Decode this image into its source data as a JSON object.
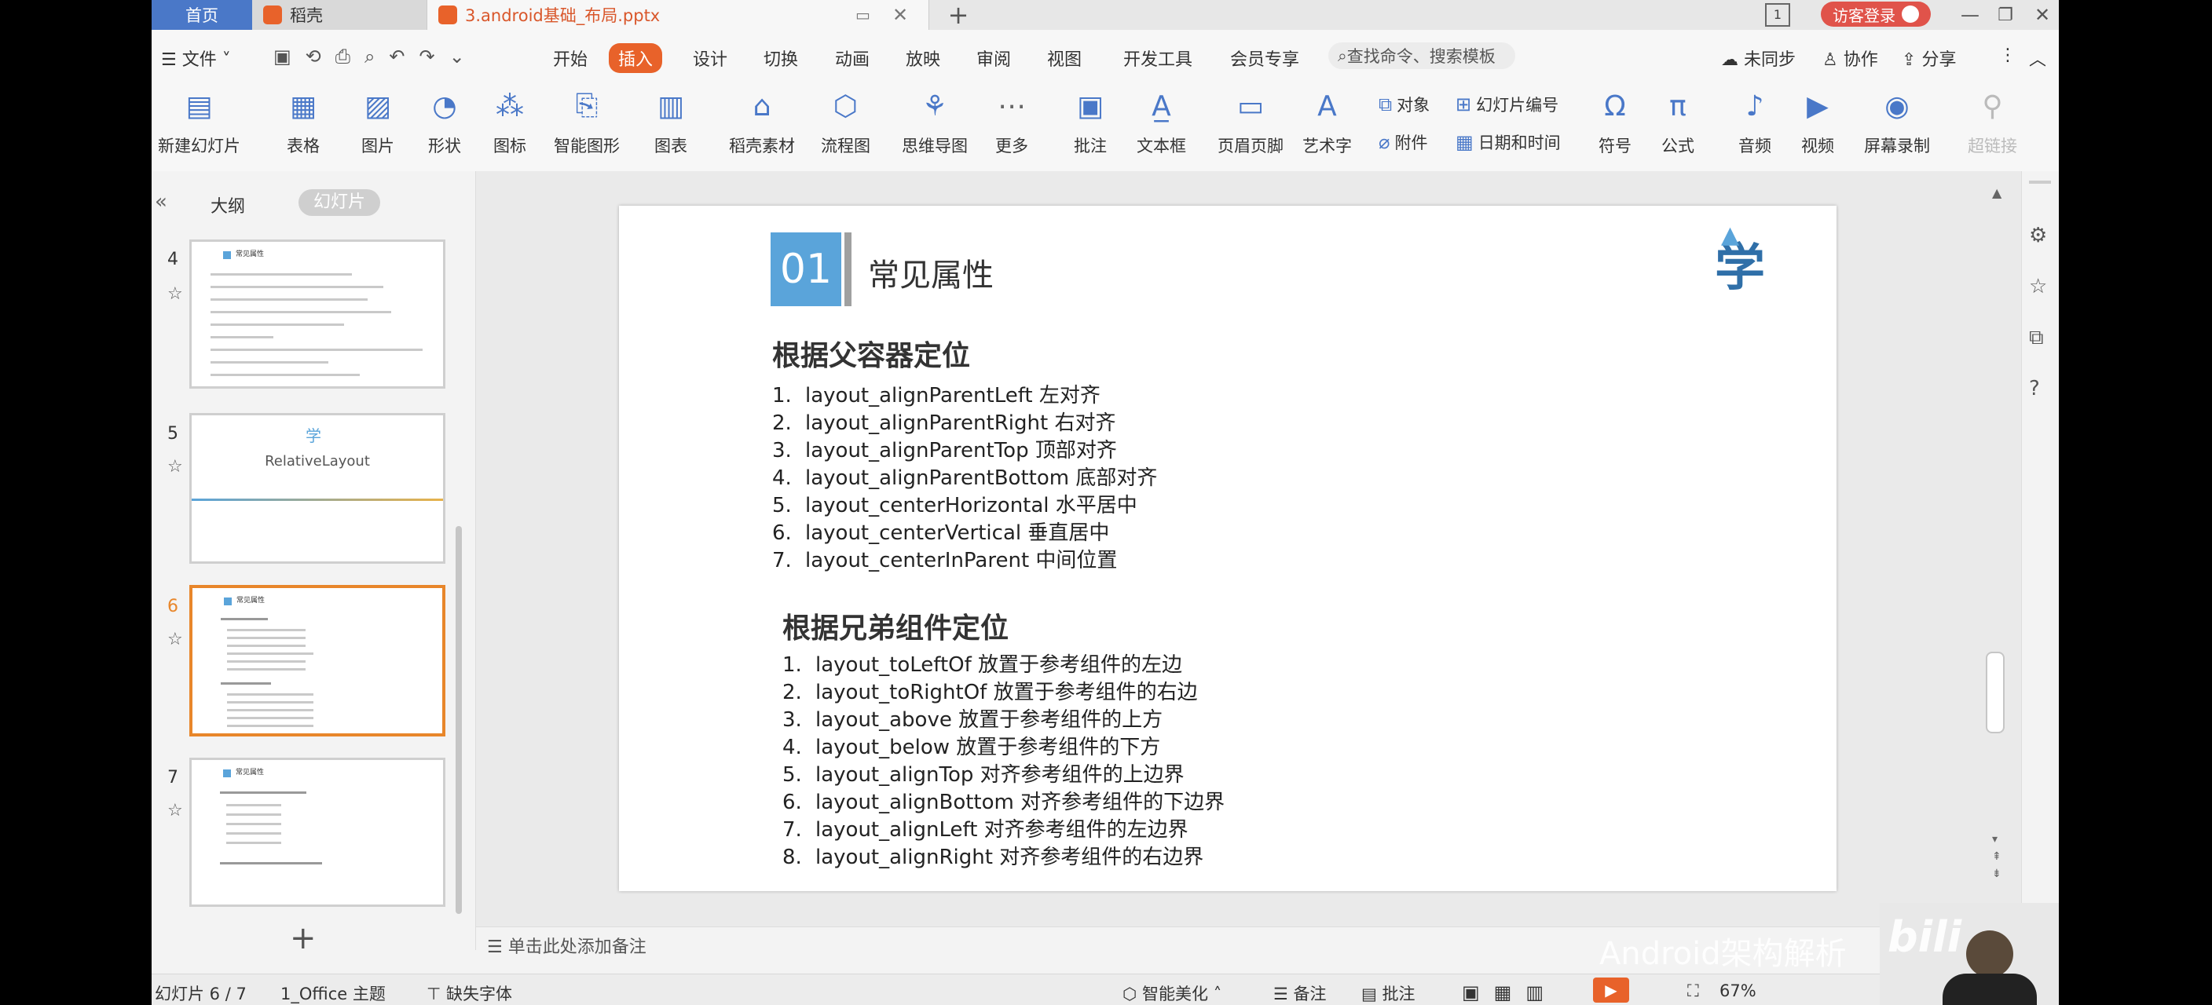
{
  "titlebar": {
    "home_tab": "首页",
    "daoke_tab": "稻壳",
    "doc_tab": "3.android基础_布局.pptx",
    "login": "访客登录",
    "page_badge": "1"
  },
  "menu": {
    "file": "文件",
    "items": [
      "开始",
      "插入",
      "设计",
      "切换",
      "动画",
      "放映",
      "审阅",
      "视图",
      "开发工具",
      "会员专享"
    ],
    "active": "插入",
    "search_placeholder": "查找命令、搜索模板",
    "sync": "未同步",
    "collab": "协作",
    "share": "分享"
  },
  "ribbon": {
    "new_slide": "新建幻灯片",
    "table": "表格",
    "picture": "图片",
    "shape": "形状",
    "icon": "图标",
    "smart_art": "智能图形",
    "chart": "图表",
    "daoke_material": "稻壳素材",
    "flowchart": "流程图",
    "mindmap": "思维导图",
    "more": "更多",
    "comment": "批注",
    "textbox": "文本框",
    "header_footer": "页眉页脚",
    "art_text": "艺术字",
    "object": "对象",
    "slide_number": "幻灯片编号",
    "attachment": "附件",
    "datetime": "日期和时间",
    "symbol": "符号",
    "formula": "公式",
    "audio": "音频",
    "video": "视频",
    "screen_record": "屏幕录制",
    "hyperlink": "超链接"
  },
  "panel": {
    "outline_tab": "大纲",
    "slides_tab": "幻灯片",
    "thumbs": [
      {
        "num": "4",
        "title": "常见属性"
      },
      {
        "num": "5",
        "title": "RelativeLayout"
      },
      {
        "num": "6",
        "title": "常见属性"
      },
      {
        "num": "7",
        "title": "常见属性"
      }
    ],
    "add": "+"
  },
  "slide": {
    "number": "01",
    "section_title": "常见属性",
    "logo_text": "学",
    "group1_title": "根据父容器定位",
    "group1_items": [
      {
        "n": "1.",
        "text": "layout_alignParentLeft 左对齐"
      },
      {
        "n": "2.",
        "text": "layout_alignParentRight 右对齐"
      },
      {
        "n": "3.",
        "text": "layout_alignParentTop 顶部对齐"
      },
      {
        "n": "4.",
        "text": "layout_alignParentBottom 底部对齐"
      },
      {
        "n": "5.",
        "text": "layout_centerHorizontal 水平居中"
      },
      {
        "n": "6.",
        "text": "layout_centerVertical 垂直居中"
      },
      {
        "n": "7.",
        "text": "layout_centerInParent 中间位置"
      }
    ],
    "group2_title": "根据兄弟组件定位",
    "group2_items": [
      {
        "n": "1.",
        "text": "layout_toLeftOf 放置于参考组件的左边"
      },
      {
        "n": "2.",
        "text": "layout_toRightOf 放置于参考组件的右边"
      },
      {
        "n": "3.",
        "text": "layout_above 放置于参考组件的上方"
      },
      {
        "n": "4.",
        "text": "layout_below 放置于参考组件的下方"
      },
      {
        "n": "5.",
        "text": "layout_alignTop 对齐参考组件的上边界"
      },
      {
        "n": "6.",
        "text": "layout_alignBottom 对齐参考组件的下边界"
      },
      {
        "n": "7.",
        "text": "layout_alignLeft 对齐参考组件的左边界"
      },
      {
        "n": "8.",
        "text": "layout_alignRight 对齐参考组件的右边界"
      }
    ]
  },
  "notes": {
    "placeholder": "单击此处添加备注"
  },
  "status": {
    "slide_pos": "幻灯片 6 / 7",
    "theme": "1_Office 主题",
    "missing_font": "缺失字体",
    "beautify": "智能美化",
    "notes": "备注",
    "comments": "批注",
    "zoom": "67%"
  },
  "watermark": "Android架构解析",
  "colors": {
    "accent": "#e8622a",
    "slide_blue": "#5aa4da",
    "selected_border": "#e8862a"
  }
}
